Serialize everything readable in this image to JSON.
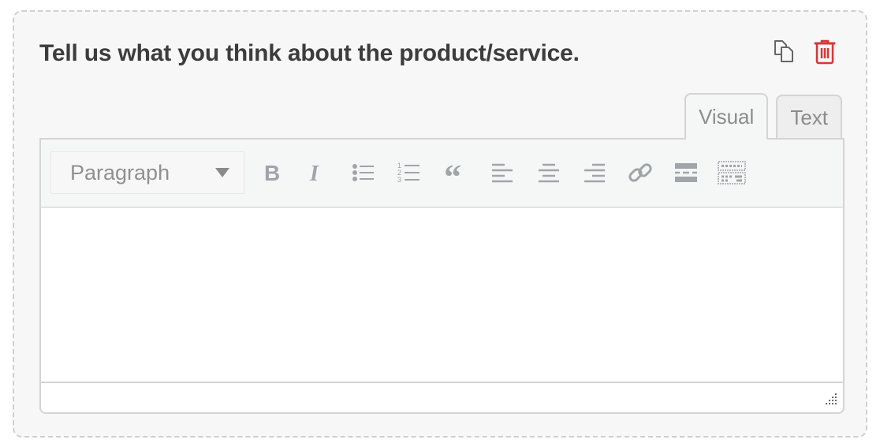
{
  "question": {
    "title": "Tell us what you think about the product/service."
  },
  "actions": {
    "duplicate_icon": "duplicate-icon",
    "delete_icon": "trash-icon",
    "delete_color": "#d63638"
  },
  "editor": {
    "tabs": [
      {
        "label": "Visual",
        "active": true
      },
      {
        "label": "Text",
        "active": false
      }
    ],
    "format_select": {
      "value": "Paragraph"
    },
    "toolbar_buttons": [
      "bold",
      "italic",
      "bulleted-list",
      "numbered-list",
      "blockquote",
      "align-left",
      "align-center",
      "align-right",
      "insert-link",
      "read-more",
      "toolbar-toggle"
    ],
    "content": "",
    "icon_color": "#a0a5aa"
  }
}
